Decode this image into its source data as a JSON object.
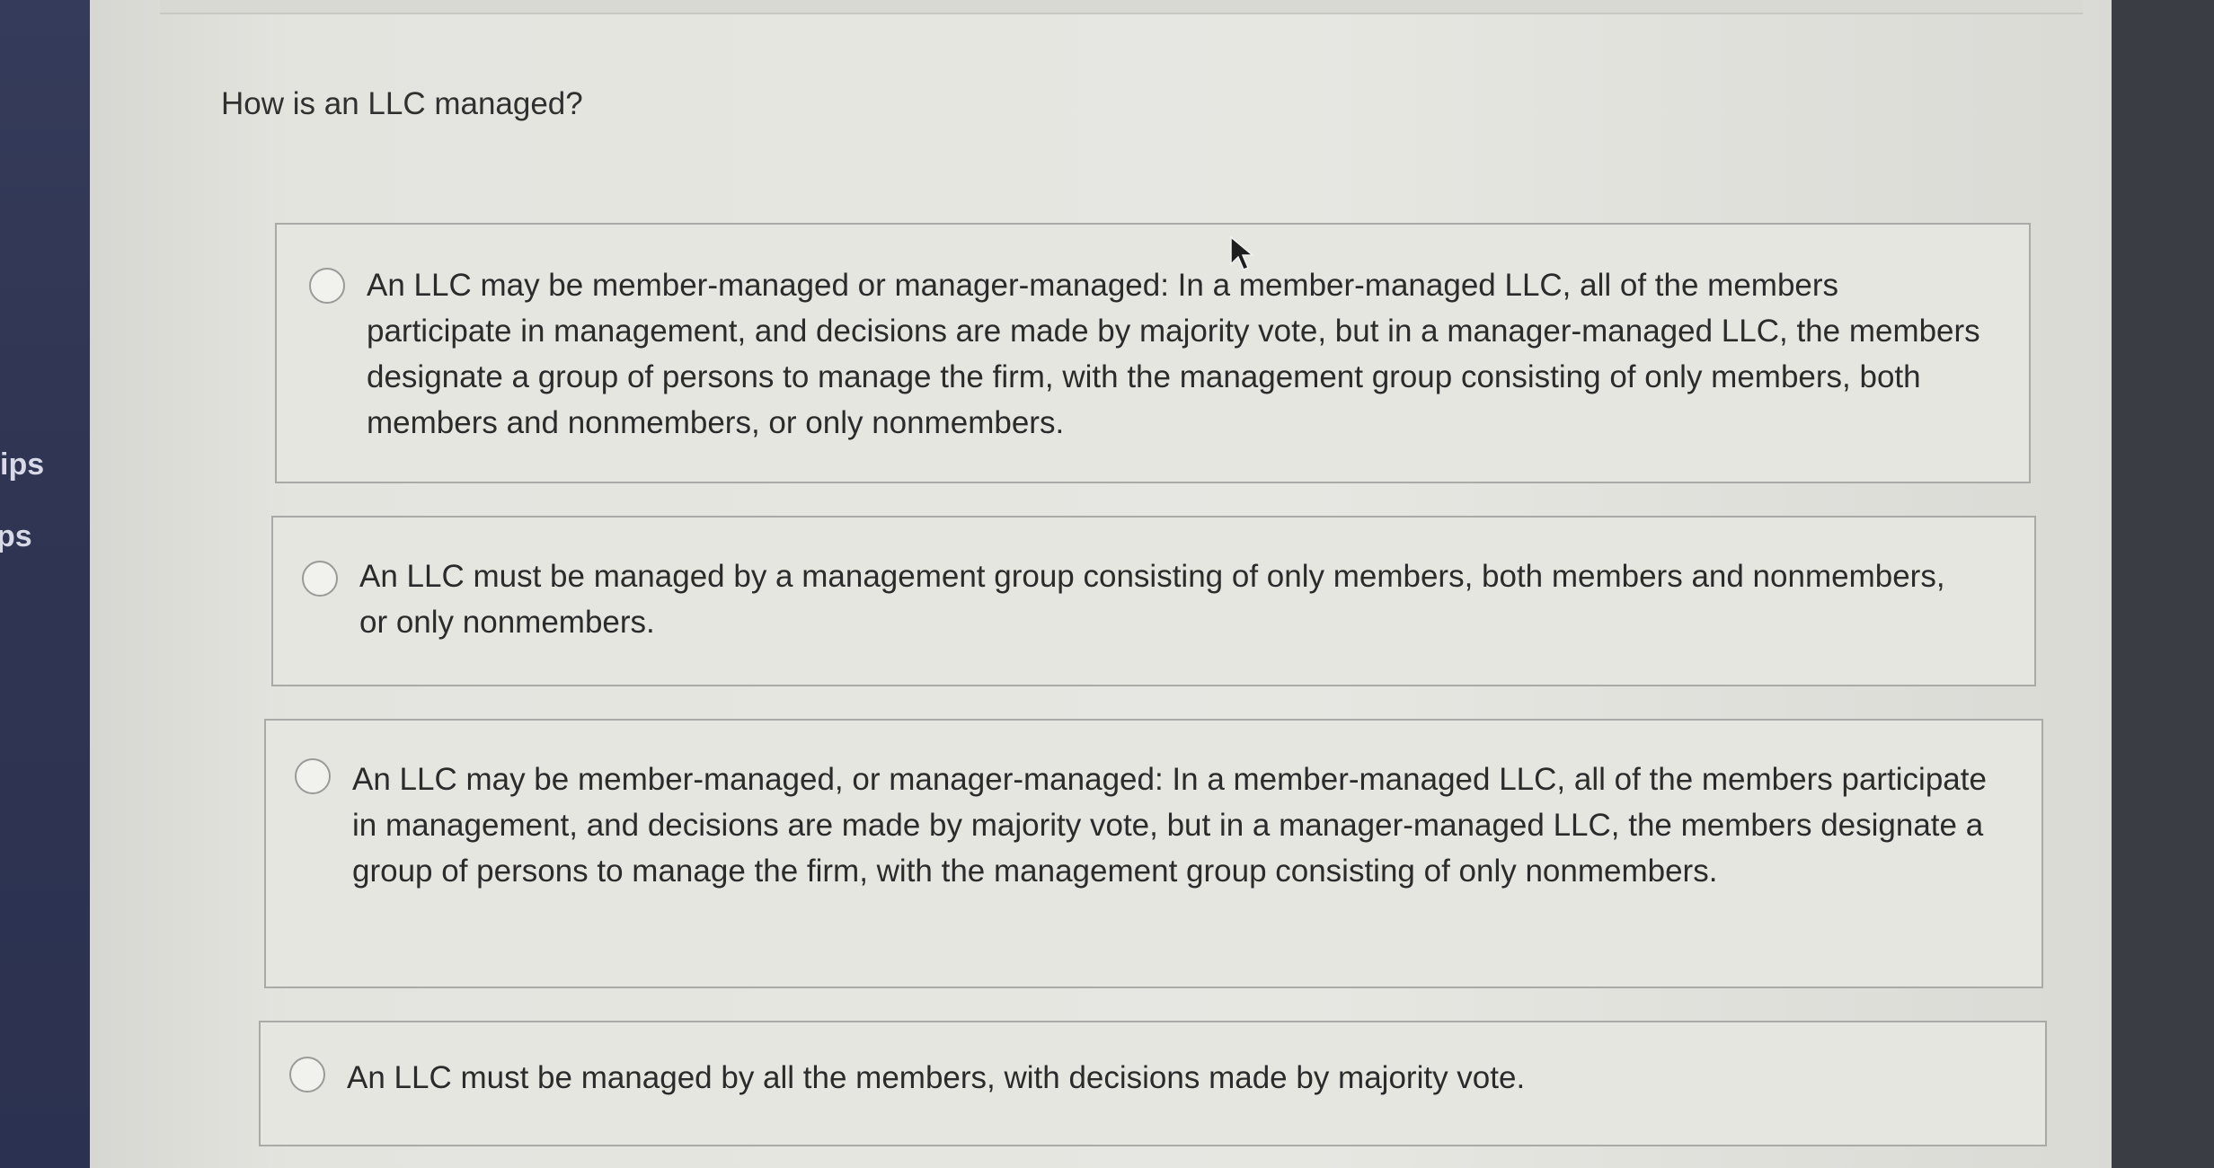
{
  "sidebar": {
    "items": [
      {
        "label": "ips"
      },
      {
        "label": "ps"
      }
    ]
  },
  "question": {
    "text": "How is an LLC managed?"
  },
  "options": [
    {
      "text": "An LLC may be member-managed or manager-managed: In a member-managed LLC, all of the members participate in management, and decisions are made by majority vote, but in a manager-managed LLC, the members designate a group of persons to manage the firm, with the management group consisting of only members, both members and nonmembers, or only nonmembers.",
      "selected": false
    },
    {
      "text": "An LLC must be managed by a management group consisting of only members, both members and nonmembers, or only nonmembers.",
      "selected": false
    },
    {
      "text": "An LLC may be member-managed, or manager-managed: In a member-managed LLC, all of the members participate in management, and decisions are made by majority vote, but in a manager-managed LLC, the members designate a group of persons to manage the firm, with the management group consisting of only nonmembers.",
      "selected": false
    },
    {
      "text": "An LLC must be managed by all the members, with decisions made by majority vote.",
      "selected": false
    }
  ],
  "icons": {
    "cursor": "mouse-pointer-icon",
    "radio": "radio-unselected-icon"
  }
}
